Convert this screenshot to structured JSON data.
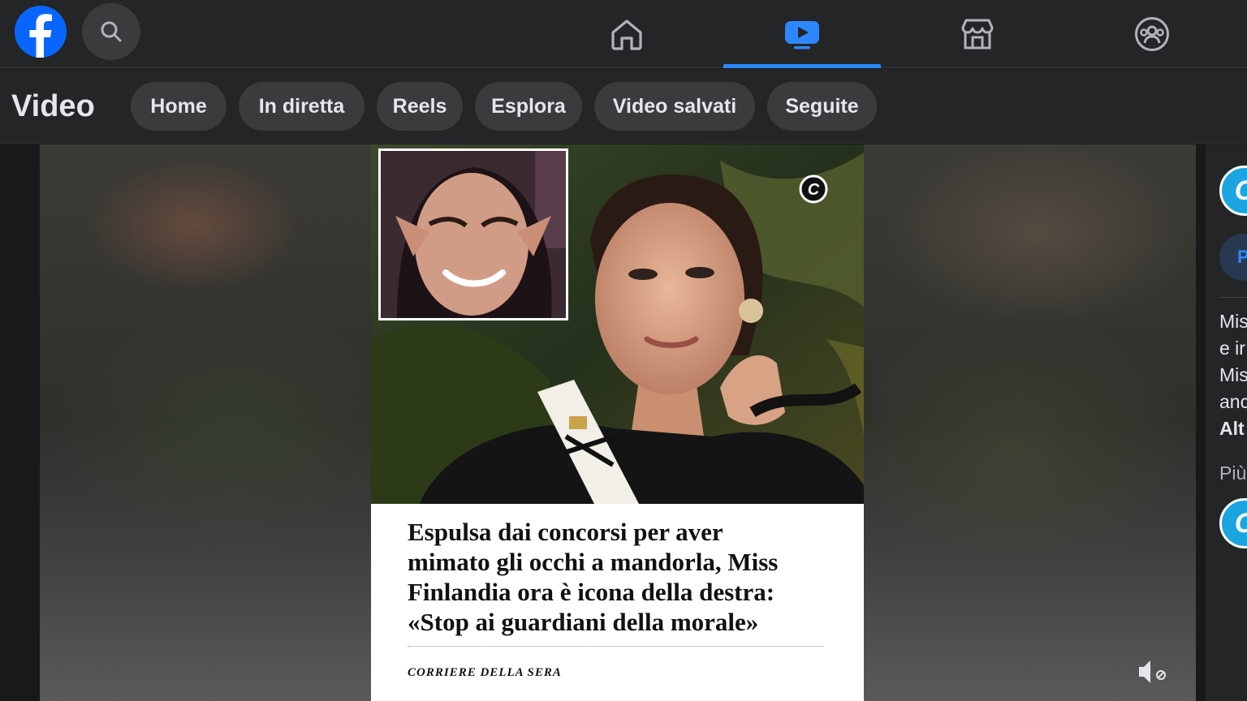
{
  "app": {
    "name": "Facebook"
  },
  "colors": {
    "accent": "#2d88ff",
    "topbar_bg": "#242526",
    "page_bg": "#18191a",
    "chip_bg": "#3a3b3c"
  },
  "topnav": {
    "icons": [
      "facebook-logo",
      "search-icon",
      "home-icon",
      "video-icon",
      "marketplace-icon",
      "groups-icon"
    ],
    "active_tab": "video"
  },
  "subheader": {
    "title": "Video",
    "chips": [
      "Home",
      "In diretta",
      "Reels",
      "Esplora",
      "Video salvati",
      "Seguite"
    ]
  },
  "video": {
    "headline_lines": [
      "Espulsa dai concorsi per aver",
      "mimato gli occhi a mandorla, Miss",
      "Finlandia ora è icona della destra:",
      "«Stop ai guardiani della morale»"
    ],
    "source": "CORRIERE DELLA SERA",
    "corner_logo_letter": "C"
  },
  "rail": {
    "avatar_letter": "C",
    "follow_label": "P",
    "text_lines": [
      "Mis",
      "e ir",
      "Mis",
      "anc"
    ],
    "text_bold": "Alt",
    "more_label": "Più"
  }
}
